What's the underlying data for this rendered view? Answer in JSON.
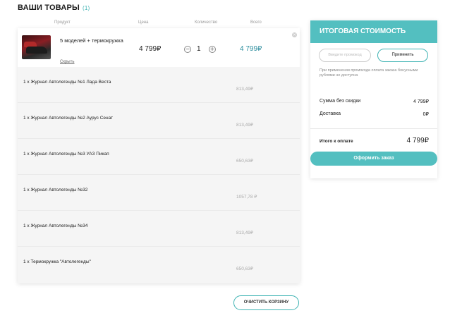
{
  "page": {
    "title": "ВАШИ ТОВАРЫ",
    "count": "(1)"
  },
  "columns": {
    "product": "Продукт",
    "price": "Цена",
    "quantity": "Количество",
    "total": "Всего"
  },
  "product": {
    "name": "5 моделей + термокружка",
    "hide_link": "Скрыть",
    "price": "4 799₽",
    "quantity": "1",
    "minus": "−",
    "plus": "+",
    "total": "4 799₽",
    "remove": "×"
  },
  "items": [
    {
      "name": "1 x Журнал Автолегенды №1 Лада Веста",
      "price": "813,49₽"
    },
    {
      "name": "1 x Журнал Автолегенды №2 Аурус Сенат",
      "price": "813,49₽"
    },
    {
      "name": "1 x Журнал Автолегенды №3 УАЗ Пикап",
      "price": "650,63₽"
    },
    {
      "name": "1 x Журнал Автолегенды №32",
      "price": "1057,78 ₽"
    },
    {
      "name": "1 x Журнал Автолегенды №34",
      "price": "813,49₽"
    },
    {
      "name": "1 x Термокружка \"Автолегенды\"",
      "price": "650,63₽"
    }
  ],
  "clear_cart": "ОЧИСТИТЬ КОРЗИНУ",
  "summary": {
    "title": "ИТОГОВАЯ СТОИМОСТЬ",
    "promo_placeholder": "Введите промокод",
    "apply_label": "Применить",
    "promo_note": "При применении промокода оплата заказа бонусными рублями не доступна",
    "subtotal_label": "Сумма без скидки",
    "subtotal_value": "4 799₽",
    "delivery_label": "Доставка",
    "delivery_value": "0₽",
    "pay_label": "Итого к оплате",
    "pay_value": "4 799₽",
    "checkout_label": "Оформить заказ"
  }
}
